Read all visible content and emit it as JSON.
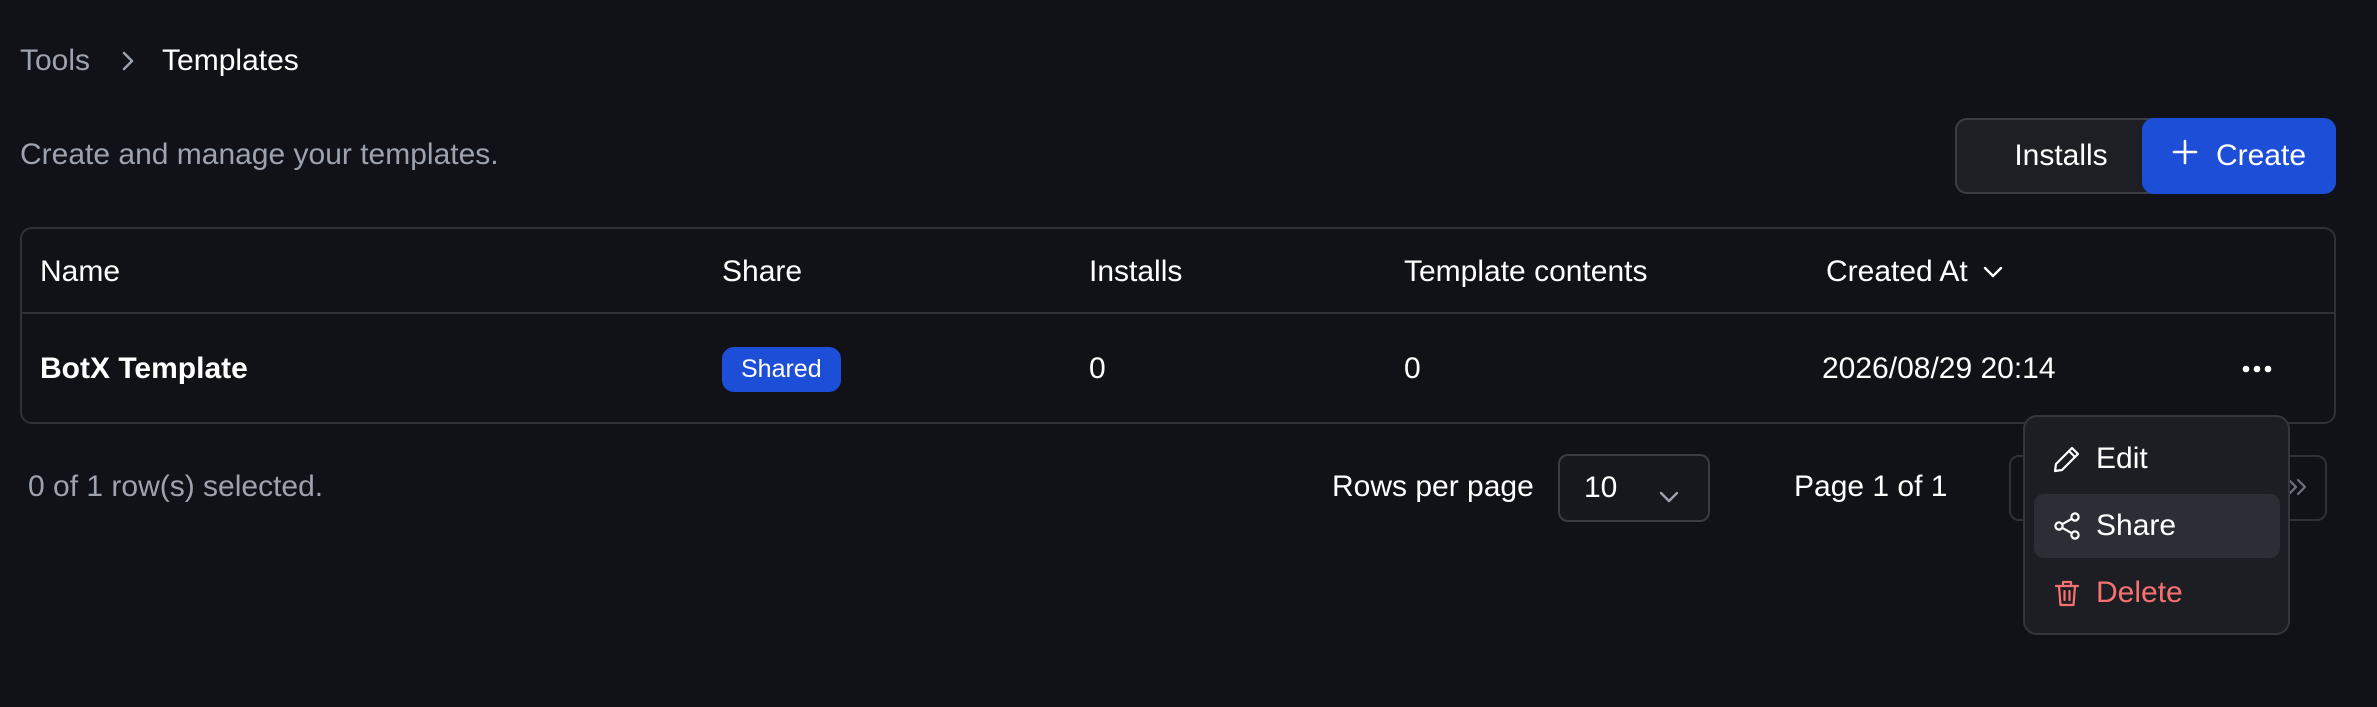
{
  "breadcrumb": {
    "parent": "Tools",
    "current": "Templates"
  },
  "header": {
    "subtitle": "Create and manage your templates.",
    "installs_label": "Installs",
    "create_label": "Create"
  },
  "table": {
    "columns": {
      "name": "Name",
      "share": "Share",
      "installs": "Installs",
      "template_contents": "Template contents",
      "created_at": "Created At"
    },
    "rows": [
      {
        "name": "BotX Template",
        "share": "Shared",
        "installs": "0",
        "template_contents": "0",
        "created_at": "2026/08/29 20:14"
      }
    ]
  },
  "footer": {
    "selected_text": "0 of 1 row(s) selected.",
    "rows_per_page_label": "Rows per page",
    "rows_per_page_value": "10",
    "page_text": "Page 1 of 1"
  },
  "row_menu": {
    "items": [
      {
        "label": "Edit",
        "icon": "pencil-icon"
      },
      {
        "label": "Share",
        "icon": "share-icon"
      },
      {
        "label": "Delete",
        "icon": "trash-icon"
      }
    ]
  },
  "colors": {
    "background": "#111217",
    "accent": "#1d4ed8",
    "danger": "#f87171",
    "muted_text": "#9ca3af"
  }
}
